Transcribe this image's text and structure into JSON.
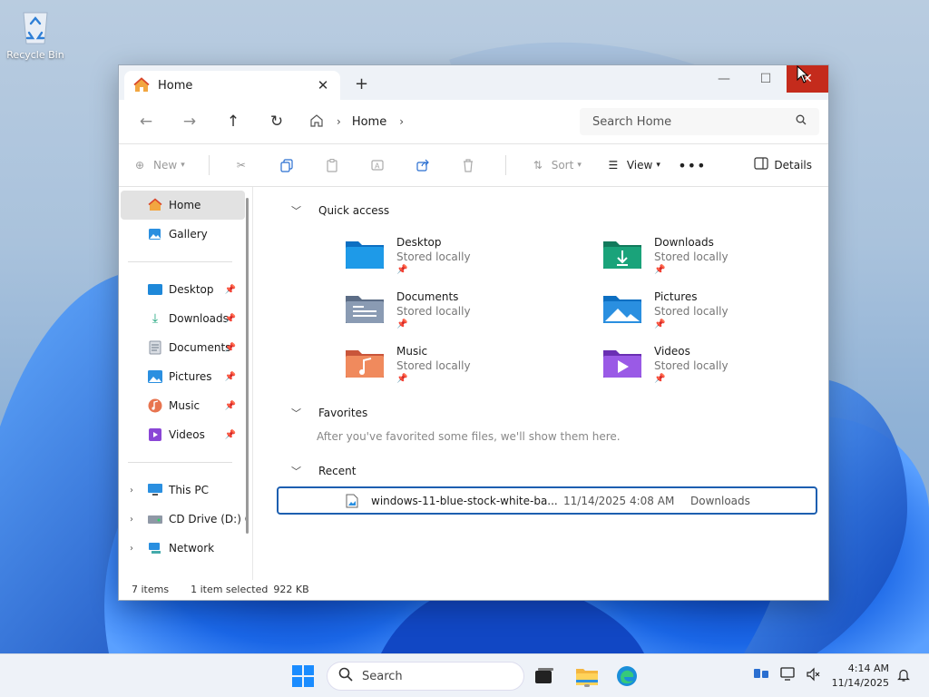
{
  "desktop": {
    "icons": [
      {
        "label": "Recycle Bin",
        "icon": "recycle-bin-icon"
      }
    ]
  },
  "window": {
    "tab_title": "Home",
    "nav": {
      "address_segments": [
        "Home"
      ],
      "search_placeholder": "Search Home"
    },
    "commands": {
      "new": "New",
      "sort": "Sort",
      "view": "View",
      "details": "Details"
    },
    "sidebar": {
      "top": [
        {
          "label": "Home",
          "icon": "home-icon",
          "active": true
        },
        {
          "label": "Gallery",
          "icon": "gallery-icon"
        }
      ],
      "pinned": [
        {
          "label": "Desktop",
          "icon": "desktop-folder-icon"
        },
        {
          "label": "Downloads",
          "icon": "download-icon"
        },
        {
          "label": "Documents",
          "icon": "documents-icon"
        },
        {
          "label": "Pictures",
          "icon": "pictures-icon"
        },
        {
          "label": "Music",
          "icon": "music-icon"
        },
        {
          "label": "Videos",
          "icon": "videos-icon"
        }
      ],
      "drives": [
        {
          "label": "This PC",
          "icon": "this-pc-icon"
        },
        {
          "label": "CD Drive (D:) CC",
          "icon": "cd-drive-icon"
        },
        {
          "label": "Network",
          "icon": "network-icon"
        }
      ]
    },
    "quick_access": {
      "heading": "Quick access",
      "items": [
        {
          "name": "Desktop",
          "status": "Stored locally",
          "color": "#1e88d9"
        },
        {
          "name": "Downloads",
          "status": "Stored locally",
          "color": "#1aa37a"
        },
        {
          "name": "Documents",
          "status": "Stored locally",
          "color": "#7a8ca6"
        },
        {
          "name": "Pictures",
          "status": "Stored locally",
          "color": "#2a8fe0"
        },
        {
          "name": "Music",
          "status": "Stored locally",
          "color": "#e8744f"
        },
        {
          "name": "Videos",
          "status": "Stored locally",
          "color": "#8a46d6"
        }
      ]
    },
    "favorites": {
      "heading": "Favorites",
      "empty_note": "After you've favorited some files, we'll show them here."
    },
    "recent": {
      "heading": "Recent",
      "files": [
        {
          "name": "windows-11-blue-stock-white-ba...",
          "date": "11/14/2025 4:08 AM",
          "location": "Downloads"
        }
      ]
    },
    "status": {
      "items": "7 items",
      "selected": "1 item selected",
      "size": "922 KB"
    }
  },
  "taskbar": {
    "search_label": "Search",
    "time": "4:14 AM",
    "date": "11/14/2025"
  },
  "colors": {
    "accent": "#1d5fb0",
    "close": "#c42b1c"
  }
}
